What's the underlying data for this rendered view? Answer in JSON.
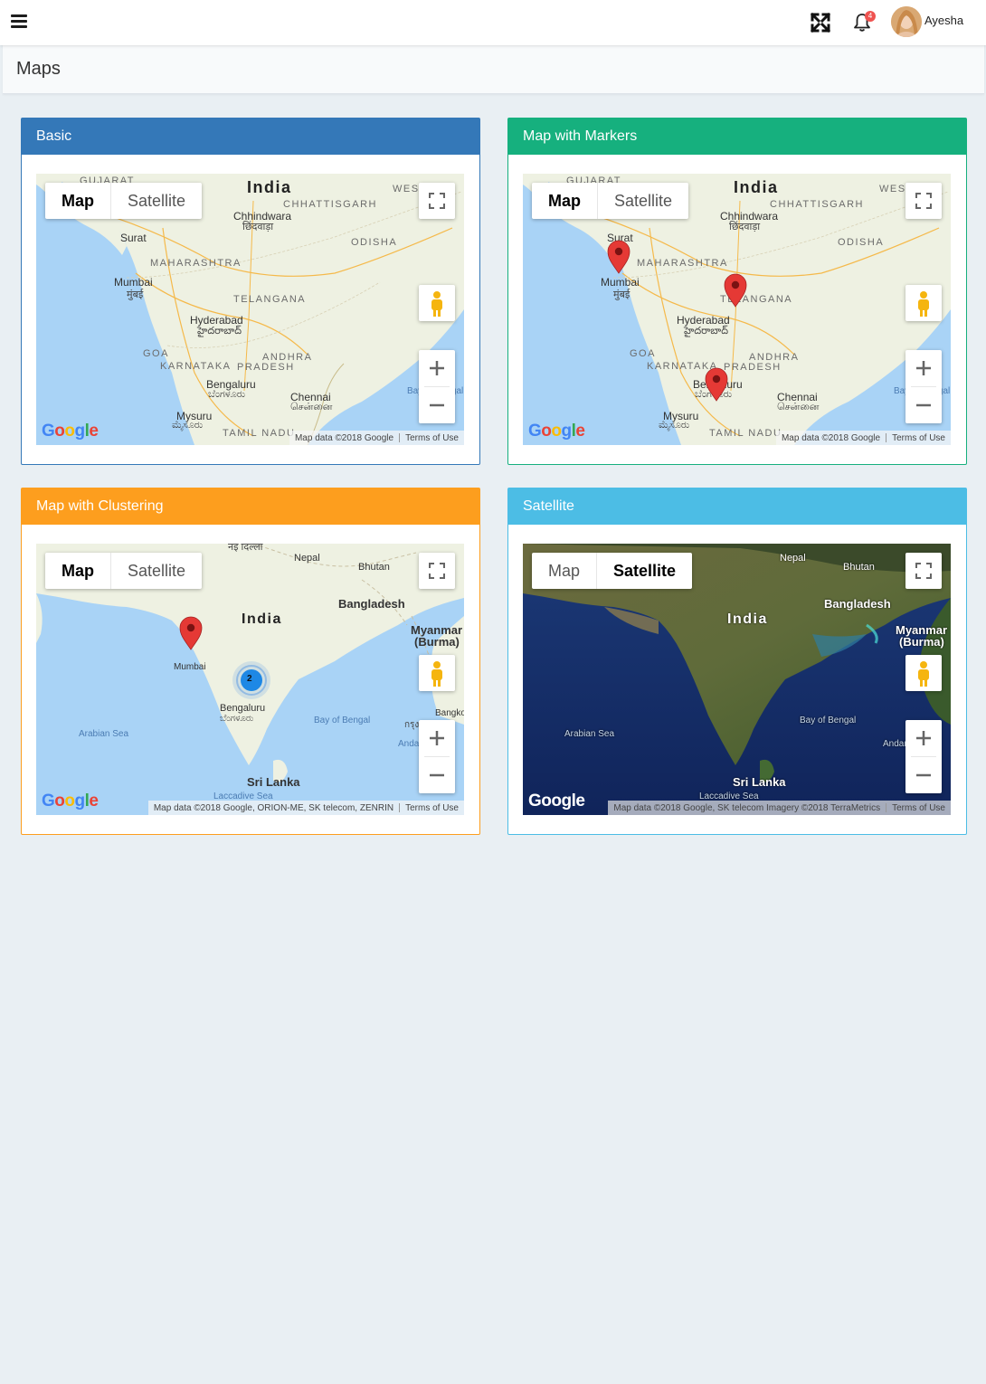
{
  "header": {
    "user_name": "Ayesha",
    "notification_count": "4",
    "icons": [
      "menu-icon",
      "fullscreen-icon",
      "bell-icon"
    ]
  },
  "page": {
    "title": "Maps"
  },
  "colors": {
    "basic": "#3478b8",
    "markers": "#16b07e",
    "clustering": "#fd9e1e",
    "satellite": "#4cbde5"
  },
  "cards": {
    "basic": {
      "title": "Basic",
      "map_btn": "Map",
      "satellite_btn": "Satellite",
      "attribution": "Map data ©2018 Google",
      "terms": "Terms of Use",
      "labels": {
        "gujarat": "GUJARAT",
        "india": "India",
        "west": "WEST",
        "chhindwara": "Chhindwara",
        "chhindwara_hi": "छिंदवाड़ा",
        "chhattisgarh": "CHHATTISGARH",
        "surat": "Surat",
        "odisha": "ODISHA",
        "maharashtra": "MAHARASHTRA",
        "mumbai": "Mumbai",
        "mumbai_hi": "मुंबई",
        "telangana": "TELANGANA",
        "hyderabad": "Hyderabad",
        "hyderabad_te": "హైదరాబాద్",
        "goa": "GOA",
        "andhra": "ANDHRA",
        "pradesh": "PRADESH",
        "karnataka": "KARNATAKA",
        "bengaluru": "Bengaluru",
        "bengaluru_kn": "ಬೆಂಗಳೂರು",
        "chennai": "Chennai",
        "chennai_ta": "சென்னை",
        "mysuru": "Mysuru",
        "mysuru_kn": "ಮೈಸೂರು",
        "tamilnadu": "TAMIL NADU",
        "bay": "Bay of Bengal"
      }
    },
    "markers": {
      "title": "Map with Markers",
      "map_btn": "Map",
      "satellite_btn": "Satellite",
      "attribution": "Map data ©2018 Google",
      "terms": "Terms of Use"
    },
    "clustering": {
      "title": "Map with Clustering",
      "map_btn": "Map",
      "satellite_btn": "Satellite",
      "attribution": "Map data ©2018 Google, ORION-ME, SK telecom, ZENRIN",
      "terms": "Terms of Use",
      "cluster_count": "2",
      "labels": {
        "nepal": "Nepal",
        "bhutan": "Bhutan",
        "bangladesh": "Bangladesh",
        "india": "India",
        "myanmar": "Myanmar",
        "burma": "(Burma)",
        "mumbai": "Mumbai",
        "bengaluru": "Bengaluru",
        "bengaluru_kn": "ಬೆಂಗಳೂರು",
        "arabian": "Arabian Sea",
        "bay": "Bay of Bengal",
        "andaman": "Andaman",
        "bangkok": "Bangkok",
        "thai": "กรุง",
        "srilanka": "Sri Lanka",
        "laccadive": "Laccadive Sea",
        "delhi": "नई दिल्ली"
      }
    },
    "satellite": {
      "title": "Satellite",
      "map_btn": "Map",
      "satellite_btn": "Satellite",
      "attribution": "Map data ©2018 Google, SK telecom Imagery ©2018 TerraMetrics",
      "terms": "Terms of Use"
    }
  }
}
